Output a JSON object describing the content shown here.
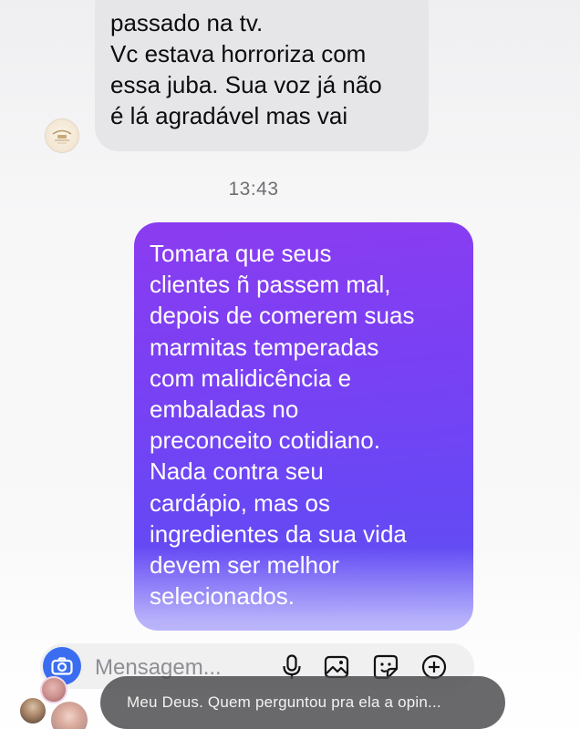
{
  "chat": {
    "incoming": {
      "lines": [
        "passado na tv.",
        "Vc estava horroriza com",
        "essa juba. Sua voz já não",
        "é lá agradável mas vai"
      ]
    },
    "timestamp": "13:43",
    "outgoing": {
      "lines": [
        "Tomara que seus",
        "clientes ñ passem mal,",
        "depois de comerem suas",
        "marmitas temperadas",
        "com malidicência e",
        "embaladas no",
        "preconceito cotidiano.",
        "Nada contra seu",
        "cardápio, mas os",
        "ingredientes da sua vida",
        "devem ser melhor",
        "selecionados."
      ]
    }
  },
  "composer": {
    "placeholder": "Mensagem...",
    "icons": [
      "camera-icon",
      "microphone-icon",
      "image-icon",
      "sticker-icon",
      "plus-icon"
    ]
  },
  "live_comment": {
    "text": "Meu Deus. Quem perguntou pra ela a opin..."
  },
  "colors": {
    "outgoing_top": "#8b3cf0",
    "outgoing_bottom": "#5b52f5",
    "incoming_bg": "#e6e6e9",
    "camera_button": "#3a6df0"
  }
}
